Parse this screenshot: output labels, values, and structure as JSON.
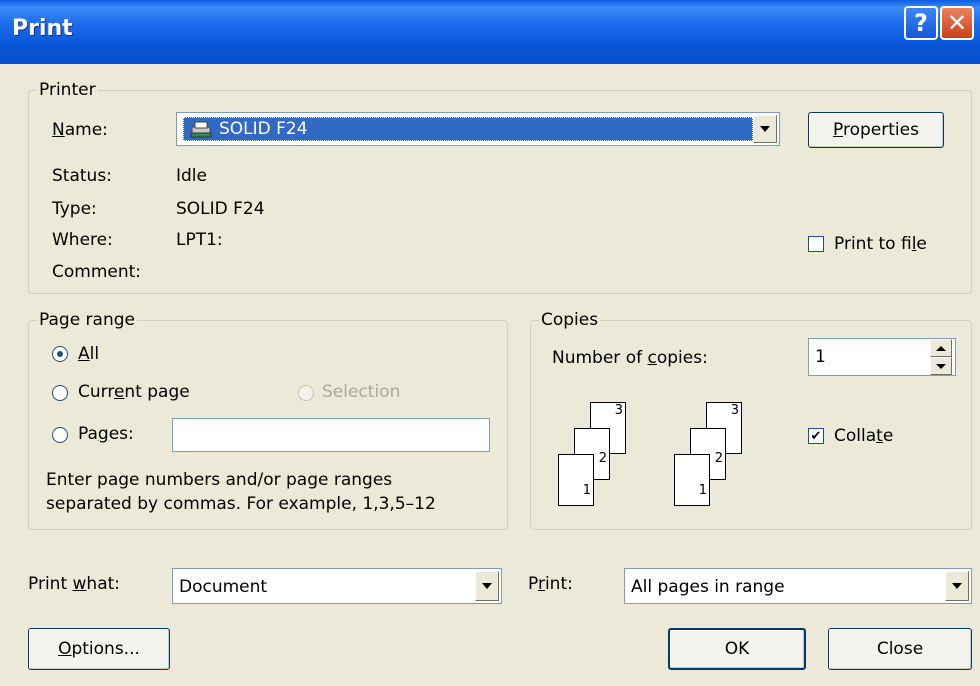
{
  "window": {
    "title": "Print",
    "help_icon": "question-mark",
    "close_icon": "x"
  },
  "printer": {
    "group_label": "Printer",
    "name_label": "Name:",
    "name_value": "SOLID F24",
    "printer_icon": "printer-icon",
    "properties_label": "Properties",
    "status_label": "Status:",
    "status_value": "Idle",
    "type_label": "Type:",
    "type_value": "SOLID F24",
    "where_label": "Where:",
    "where_value": "LPT1:",
    "comment_label": "Comment:",
    "comment_value": "",
    "print_to_file_label": "Print to file",
    "print_to_file_checked": false
  },
  "page_range": {
    "group_label": "Page range",
    "all_label": "All",
    "all_selected": true,
    "current_page_label": "Current page",
    "selection_label": "Selection",
    "pages_label": "Pages:",
    "pages_value": "",
    "hint_line1": "Enter page numbers and/or page ranges",
    "hint_line2": "separated by commas.  For example, 1,3,5–12"
  },
  "copies": {
    "group_label": "Copies",
    "number_label": "Number of copies:",
    "number_value": "1",
    "collate_label": "Collate",
    "collate_checked": true,
    "page_numbers": [
      "1",
      "2",
      "3"
    ]
  },
  "print_what": {
    "label": "Print what:",
    "value": "Document"
  },
  "print": {
    "label": "Print:",
    "value": "All pages in range"
  },
  "buttons": {
    "options": "Options...",
    "ok": "OK",
    "close": "Close"
  },
  "colors": {
    "titlebar": "#0a56d8",
    "selection_highlight": "#316ac5",
    "dialog_bg": "#ece9d8"
  }
}
